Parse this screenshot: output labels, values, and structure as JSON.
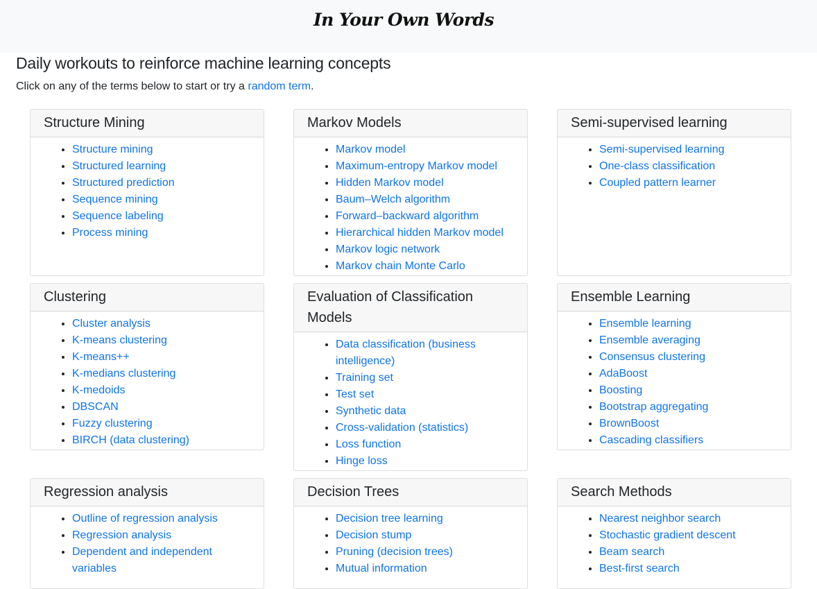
{
  "header": {
    "brand": "In Your Own Words"
  },
  "page": {
    "title": "Daily workouts to reinforce machine learning concepts",
    "intro_before": "Click on any of the terms below to start or try a ",
    "intro_link": "random term",
    "intro_after": "."
  },
  "cards": [
    {
      "title": "Structure Mining",
      "items": [
        "Structure mining",
        "Structured learning",
        "Structured prediction",
        "Sequence mining",
        "Sequence labeling",
        "Process mining"
      ]
    },
    {
      "title": "Markov Models",
      "items": [
        "Markov model",
        "Maximum-entropy Markov model",
        "Hidden Markov model",
        "Baum–Welch algorithm",
        "Forward–backward algorithm",
        "Hierarchical hidden Markov model",
        "Markov logic network",
        "Markov chain Monte Carlo"
      ]
    },
    {
      "title": "Semi-supervised learning",
      "items": [
        "Semi-supervised learning",
        "One-class classification",
        "Coupled pattern learner"
      ]
    },
    {
      "title": "Clustering",
      "items": [
        "Cluster analysis",
        "K-means clustering",
        "K-means++",
        "K-medians clustering",
        "K-medoids",
        "DBSCAN",
        "Fuzzy clustering",
        "BIRCH (data clustering)"
      ]
    },
    {
      "title": "Evaluation of Classification Models",
      "items": [
        "Data classification (business intelligence)",
        "Training set",
        "Test set",
        "Synthetic data",
        "Cross-validation (statistics)",
        "Loss function",
        "Hinge loss"
      ]
    },
    {
      "title": "Ensemble Learning",
      "items": [
        "Ensemble learning",
        "Ensemble averaging",
        "Consensus clustering",
        "AdaBoost",
        "Boosting",
        "Bootstrap aggregating",
        "BrownBoost",
        "Cascading classifiers"
      ]
    },
    {
      "title": "Regression analysis",
      "items": [
        "Outline of regression analysis",
        "Regression analysis",
        "Dependent and independent variables"
      ]
    },
    {
      "title": "Decision Trees",
      "items": [
        "Decision tree learning",
        "Decision stump",
        "Pruning (decision trees)",
        "Mutual information"
      ]
    },
    {
      "title": "Search Methods",
      "items": [
        "Nearest neighbor search",
        "Stochastic gradient descent",
        "Beam search",
        "Best-first search"
      ]
    }
  ]
}
